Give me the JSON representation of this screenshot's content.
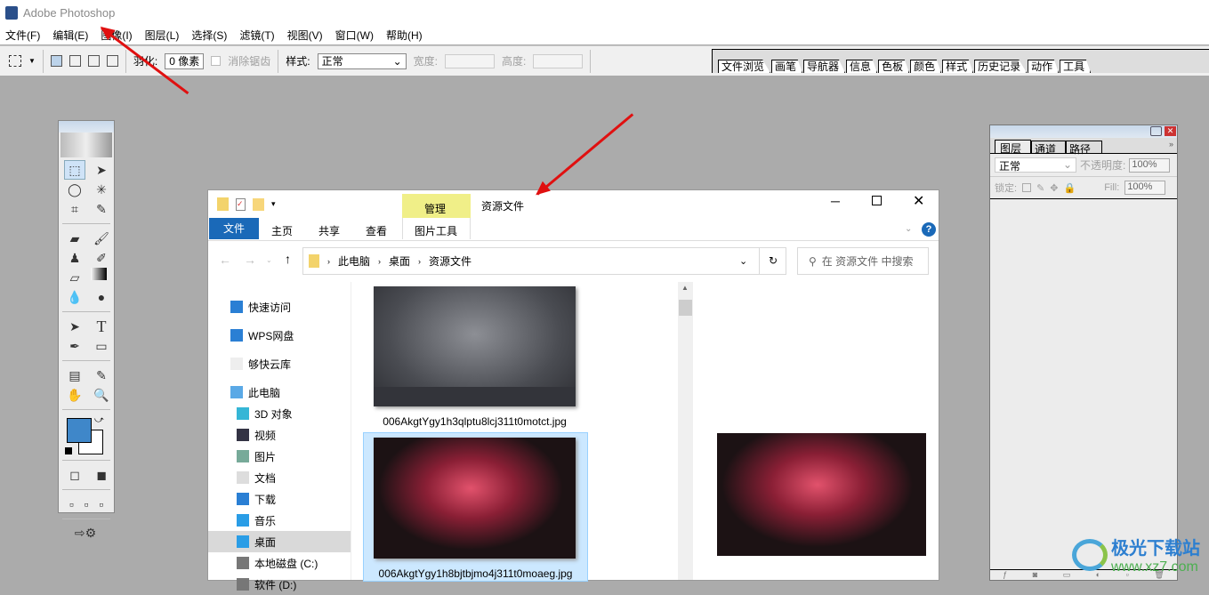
{
  "app": {
    "title": "Adobe Photoshop"
  },
  "menu": [
    "文件(F)",
    "编辑(E)",
    "图像(I)",
    "图层(L)",
    "选择(S)",
    "滤镜(T)",
    "视图(V)",
    "窗口(W)",
    "帮助(H)"
  ],
  "options": {
    "feather_label": "羽化:",
    "feather_value": "0 像素",
    "antialias_label": "消除锯齿",
    "style_label": "样式:",
    "style_value": "正常",
    "width_label": "宽度:",
    "height_label": "高度:"
  },
  "palette_well_tabs": [
    "文件浏览",
    "画笔",
    "导航器",
    "信息",
    "色板",
    "颜色",
    "样式",
    "历史记录",
    "动作",
    "工具"
  ],
  "toolbox": {
    "foreground_color": "#3f87c9",
    "background_color": "#ffffff"
  },
  "explorer": {
    "title": "资源文件",
    "context_tab": "管理",
    "context_tab_sub": "图片工具",
    "context_color": "#f0ef88",
    "ribbon_tabs": [
      "文件",
      "主页",
      "共享",
      "查看"
    ],
    "breadcrumb": [
      "此电脑",
      "桌面",
      "资源文件"
    ],
    "search_placeholder": "在 资源文件 中搜索",
    "nav": [
      "快速访问",
      "WPS网盘",
      "够快云库",
      "此电脑",
      "3D 对象",
      "视频",
      "图片",
      "文档",
      "下载",
      "音乐",
      "桌面",
      "本地磁盘 (C:)",
      "软件 (D:)"
    ],
    "selected_nav": "桌面",
    "files": [
      "006AkgtYgy1h3qlptu8lcj311t0motct.jpg",
      "006AkgtYgy1h8bjtbjmo4j311t0moaeg.jpg"
    ]
  },
  "layers_panel": {
    "tabs": [
      "图层",
      "通道",
      "路径"
    ],
    "blend_mode": "正常",
    "opacity_label": "不透明度:",
    "opacity_value": "100%",
    "lock_label": "锁定:",
    "fill_label": "Fill:",
    "fill_value": "100%"
  },
  "watermark": {
    "name": "极光下载站",
    "url": "www.xz7.com"
  }
}
